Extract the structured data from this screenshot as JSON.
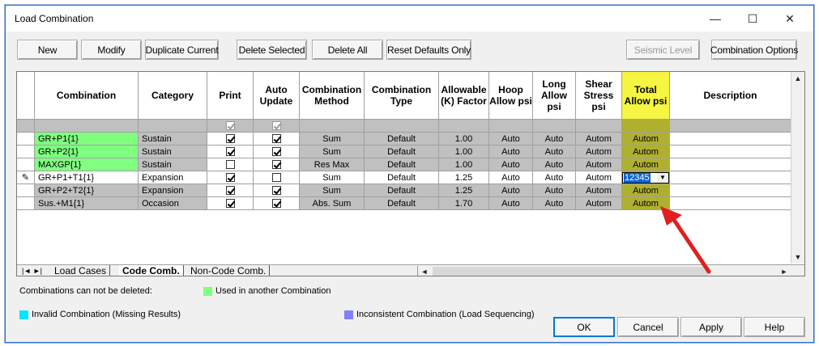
{
  "window": {
    "title": "Load Combination",
    "controls": [
      "—",
      "☐",
      "✕"
    ]
  },
  "toolbar": {
    "new": "New",
    "modify": "Modify",
    "duplicate": "Duplicate Current",
    "delete_selected": "Delete Selected",
    "delete_all": "Delete All",
    "reset_defaults": "Reset Defaults Only",
    "seismic_level": "Seismic Level",
    "combination_options": "Combination Options"
  },
  "grid": {
    "headers": [
      "Combination",
      "Category",
      "Print",
      "Auto Update",
      "Combination Method",
      "Combination Type",
      "Allowable (K) Factor",
      "Hoop Allow psi",
      "Long Allow psi",
      "Shear Stress psi",
      "Total Allow psi",
      "Description"
    ],
    "rows": [
      {
        "marker": "",
        "name": "GR+P1{1}",
        "category": "Sustain",
        "print": true,
        "auto": true,
        "method": "Sum",
        "type": "Default",
        "k": "1.00",
        "hoop": "Auto",
        "long": "Auto",
        "shear": "Autom",
        "total": "Autom",
        "used": true
      },
      {
        "marker": "",
        "name": "GR+P2{1}",
        "category": "Sustain",
        "print": true,
        "auto": true,
        "method": "Sum",
        "type": "Default",
        "k": "1.00",
        "hoop": "Auto",
        "long": "Auto",
        "shear": "Autom",
        "total": "Autom",
        "used": true
      },
      {
        "marker": "",
        "name": "MAXGP{1}",
        "category": "Sustain",
        "print": false,
        "auto": true,
        "method": "Res Max",
        "type": "Default",
        "k": "1.00",
        "hoop": "Auto",
        "long": "Auto",
        "shear": "Autom",
        "total": "Autom",
        "used": true
      },
      {
        "marker": "✎",
        "name": "GR+P1+T1{1}",
        "category": "Expansion",
        "print": true,
        "auto": false,
        "method": "Sum",
        "type": "Default",
        "k": "1.25",
        "hoop": "Auto",
        "long": "Auto",
        "shear": "Autom",
        "total": "12345",
        "used": false
      },
      {
        "marker": "",
        "name": "GR+P2+T2{1}",
        "category": "Expansion",
        "print": true,
        "auto": true,
        "method": "Sum",
        "type": "Default",
        "k": "1.25",
        "hoop": "Auto",
        "long": "Auto",
        "shear": "Autom",
        "total": "Autom",
        "used": false
      },
      {
        "marker": "",
        "name": "Sus.+M1{1}",
        "category": "Occasion",
        "print": true,
        "auto": true,
        "method": "Abs. Sum",
        "type": "Default",
        "k": "1.70",
        "hoop": "Auto",
        "long": "Auto",
        "shear": "Autom",
        "total": "Autom",
        "used": false
      }
    ]
  },
  "tabs": [
    "Load Cases",
    "Code Comb.",
    "Non-Code Comb."
  ],
  "active_tab": "Code Comb.",
  "legend": {
    "note": "Combinations can not be deleted:",
    "used": "Used in another Combination",
    "invalid": "Invalid Combination (Missing Results)",
    "inconsistent": "Inconsistent Combination (Load Sequencing)"
  },
  "buttons": {
    "ok": "OK",
    "cancel": "Cancel",
    "apply": "Apply",
    "help": "Help"
  },
  "colors": {
    "used": "#80ff80",
    "invalid": "#00e5ff",
    "inconsistent": "#8080ff",
    "highlight": "#f5f542",
    "highlight_dark": "#b0b030",
    "row_gray": "#c0c0c0",
    "arrow": "#e02020"
  }
}
